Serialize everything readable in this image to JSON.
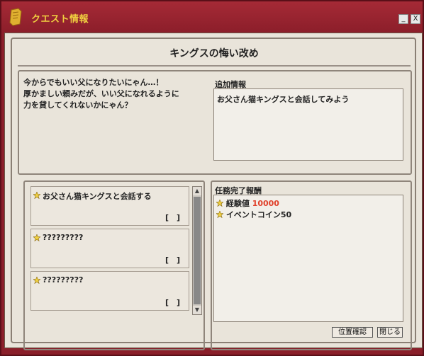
{
  "window": {
    "title": "クエスト情報",
    "minimize_label": "_",
    "close_label": "X"
  },
  "quest": {
    "title": "キングスの悔い改め",
    "description": "今からでもいい父になりたいにゃん…！\n厚かましい頼みだが、いい父になれるように\n力を貸してくれないかにゃん？"
  },
  "additional_info": {
    "label": "追加情報",
    "text": "お父さん猫キングスと会話してみよう"
  },
  "objectives": [
    {
      "text": "お父さん猫キングスと会話する",
      "status": "[　]"
    },
    {
      "text": "?????????",
      "status": "[　]"
    },
    {
      "text": "?????????",
      "status": "[　]"
    }
  ],
  "rewards": {
    "label": "任務完了報酬",
    "items": [
      {
        "name": "経験値",
        "value": "10000"
      },
      {
        "name": "イベントコイン50",
        "value": ""
      }
    ]
  },
  "buttons": {
    "locate": "位置確認",
    "close": "閉じる"
  },
  "colors": {
    "titlebar": "#8c1e2a",
    "title_text": "#f0d040",
    "parchment": "#e9e4da",
    "reward_value": "#e0402a"
  }
}
